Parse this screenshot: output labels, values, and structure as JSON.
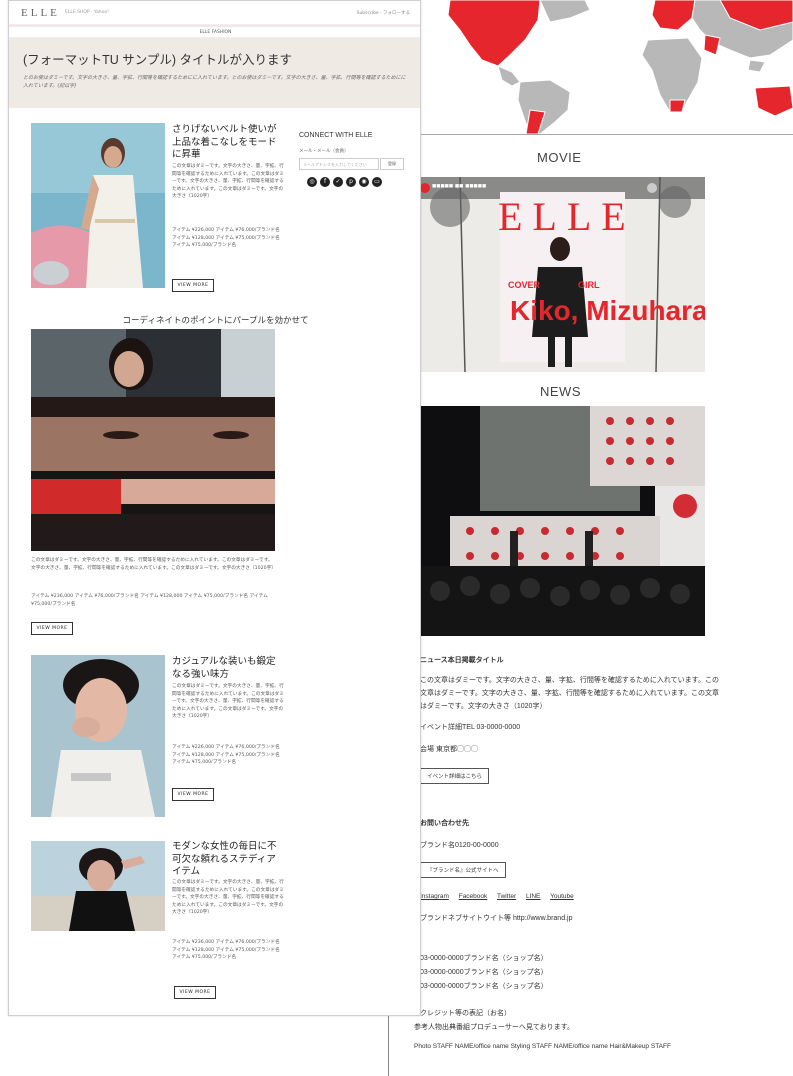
{
  "front": {
    "header": {
      "logo": "ELLE",
      "logo_sub": "ELLE SHOP · Yahoo!",
      "top_links": "Subscribe · フォローする"
    },
    "nav_label": "ELLE FASHION",
    "banner": {
      "title": "(フォーマットTU サンプル) タイトルが入ります",
      "description": "とのお使はダミーです。文字の大きさ、量、字拡、行間等を確認するためにに入れています。とのお使はダミーです。文字の大きさ、量、字拡、行間等を確認するためにに入れています。(記以字)"
    },
    "sidebar": {
      "title": "CONNECT WITH ELLE",
      "email_label": "メール・メール（会員）",
      "email_placeholder": "メールアドレスを入力してください",
      "submit_label": "登録",
      "social_icons": [
        "instagram-icon",
        "facebook-icon",
        "twitter-icon",
        "pinterest-icon",
        "line-icon",
        "youtube-icon"
      ]
    },
    "articles": [
      {
        "title": "さりげないベルト使いが上品な着こなしをモードに昇華",
        "body": "この文章はダミーです。文字の大きさ、量、字拡、行間等を確認するために入れています。この文章はダミーです。文字の大きさ、量、字拡、行間等を確認するために入れています。この文章はダミーです。文字の大きさ（1020字）",
        "prices": "アイテム ¥226,000 アイテム ¥76,000/ブランド名 アイテム ¥128,000 アイテム ¥75,000/ブランド名 アイテム ¥75,000/ブランド名",
        "button": "VIEW MORE"
      },
      {
        "section_title": "コーディネイトのポイントにパープルを効かせて",
        "body": "この文章はダミーです。文字の大きさ、量、字拡、行間等を確認するために入れています。この文章はダミーです。文字の大きさ、量、字拡、行間等を確認するために入れています。この文章はダミーです。文字の大きさ（1020字）",
        "prices": "アイテム ¥236,000 アイテム ¥76,000/ブランド名 アイテム ¥128,000 アイテム ¥75,000/ブランド名 アイテム ¥75,000/ブランド名",
        "button": "VIEW MORE"
      },
      {
        "title": "カジュアルな装いも鍛定なる強い味方",
        "body": "この文章はダミーです。文字の大きさ、量、字拡、行間等を確認するために入れています。この文章はダミーです。文字の大きさ、量、字拡、行間等を確認するために入れています。この文章はダミーです。文字の大きさ（1020字）",
        "prices": "アイテム ¥226,000 アイテム ¥76,000/ブランド名 アイテム ¥128,000 アイテム ¥75,000/ブランド名 アイテム ¥75,000/ブランド名",
        "button": "VIEW MORE"
      },
      {
        "title": "モダンな女性の毎日に不可欠な頼れるステディアイテム",
        "body": "この文章はダミーです。文字の大きさ、量、字拡、行間等を確認するために入れています。この文章はダミーです。文字の大きさ、量、字拡、行間等を確認するために入れています。この文章はダミーです。文字の大きさ（1020字）",
        "prices": "アイテム ¥236,000 アイテム ¥76,000/ブランド名 アイテム ¥128,000 アイテム ¥75,000/ブランド名 アイテム ¥75,000/ブランド名",
        "button": "VIEW MORE"
      }
    ]
  },
  "back": {
    "movie_heading": "MOVIE",
    "video": {
      "magazine_title": "ELLE",
      "cover_text_1": "COVER",
      "cover_text_2": "GIRL",
      "cover_name": "Kiko, Mizuhara"
    },
    "news_heading": "NEWS",
    "news_title": "ニュース本日掲載タイトル",
    "news_body_1": "この文章はダミーです。文字の大きさ、量、字拡、行間等を確認するために入れています。この",
    "news_body_2": "文章はダミーです。文字の大きさ、量、字拡、行間等を確認するために入れています。この文章",
    "news_body_3": "はダミーです。文字の大きさ（1020字）",
    "event_phone": "イベント詳細TEL 03-0000-0000",
    "event_place": "会場 東京都◯◯◯",
    "event_button": "イベント詳細はこちら",
    "inquiry_title": "お問い合わせ先",
    "brand_phone": "ブランド名0120-00-0000",
    "brand_button": "『ブランド名』公式サイトへ",
    "social_links": [
      "Instagram",
      "Facebook",
      "Twitter",
      "LINE",
      "Youtube"
    ],
    "brand_site": "ブランドネブサイトウイ卜等 http://www.brand.jp",
    "phone_1": "03-0000-0000ブランド名（ショップ名）",
    "phone_2": "03-0000-0000ブランド名（ショップ名）",
    "phone_3": "03-0000-0000ブランド名（ショップ名）",
    "note_title": "クレジット等の表記（お名）",
    "note_body": "参考人物出典番組プロデューサーへ見ております。",
    "credits": "Photo STAFF NAME/office name Styling STAFF NAME/office name Hair&Makeup STAFF"
  }
}
